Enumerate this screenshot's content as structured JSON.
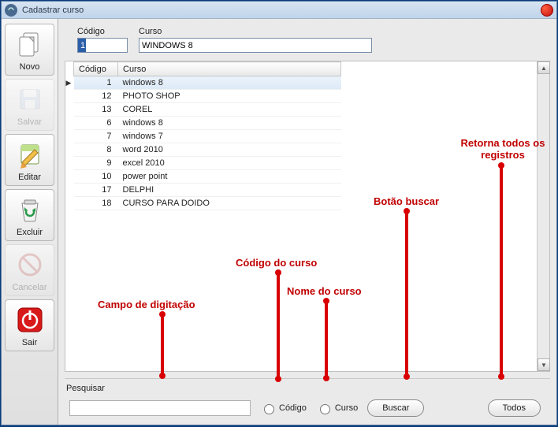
{
  "window": {
    "title": "Cadastrar curso"
  },
  "form": {
    "codigo_label": "Código",
    "codigo_value": "1",
    "curso_label": "Curso",
    "curso_value": "WINDOWS 8"
  },
  "sidebar": {
    "novo": "Novo",
    "salvar": "Salvar",
    "editar": "Editar",
    "excluir": "Excluir",
    "cancelar": "Cancelar",
    "sair": "Sair"
  },
  "table": {
    "codigo_header": "Código",
    "curso_header": "Curso",
    "rows": [
      {
        "codigo": "1",
        "curso": "windows 8"
      },
      {
        "codigo": "12",
        "curso": "PHOTO SHOP"
      },
      {
        "codigo": "13",
        "curso": "COREL"
      },
      {
        "codigo": "6",
        "curso": "windows 8"
      },
      {
        "codigo": "7",
        "curso": "windows 7"
      },
      {
        "codigo": "8",
        "curso": "word 2010"
      },
      {
        "codigo": "9",
        "curso": "excel 2010"
      },
      {
        "codigo": "10",
        "curso": "power point"
      },
      {
        "codigo": "17",
        "curso": "DELPHI"
      },
      {
        "codigo": "18",
        "curso": "CURSO PARA DOIDO"
      }
    ]
  },
  "search": {
    "pesquisar_label": "Pesquisar",
    "input_value": "",
    "radio_codigo": "Código",
    "radio_curso": "Curso",
    "buscar_label": "Buscar",
    "todos_label": "Todos"
  },
  "annotations": {
    "campo": "Campo de digitação",
    "codigo_curso": "Código do curso",
    "nome_curso": "Nome do curso",
    "botao_buscar": "Botão buscar",
    "retorna": "Retorna todos os\nregistros"
  }
}
